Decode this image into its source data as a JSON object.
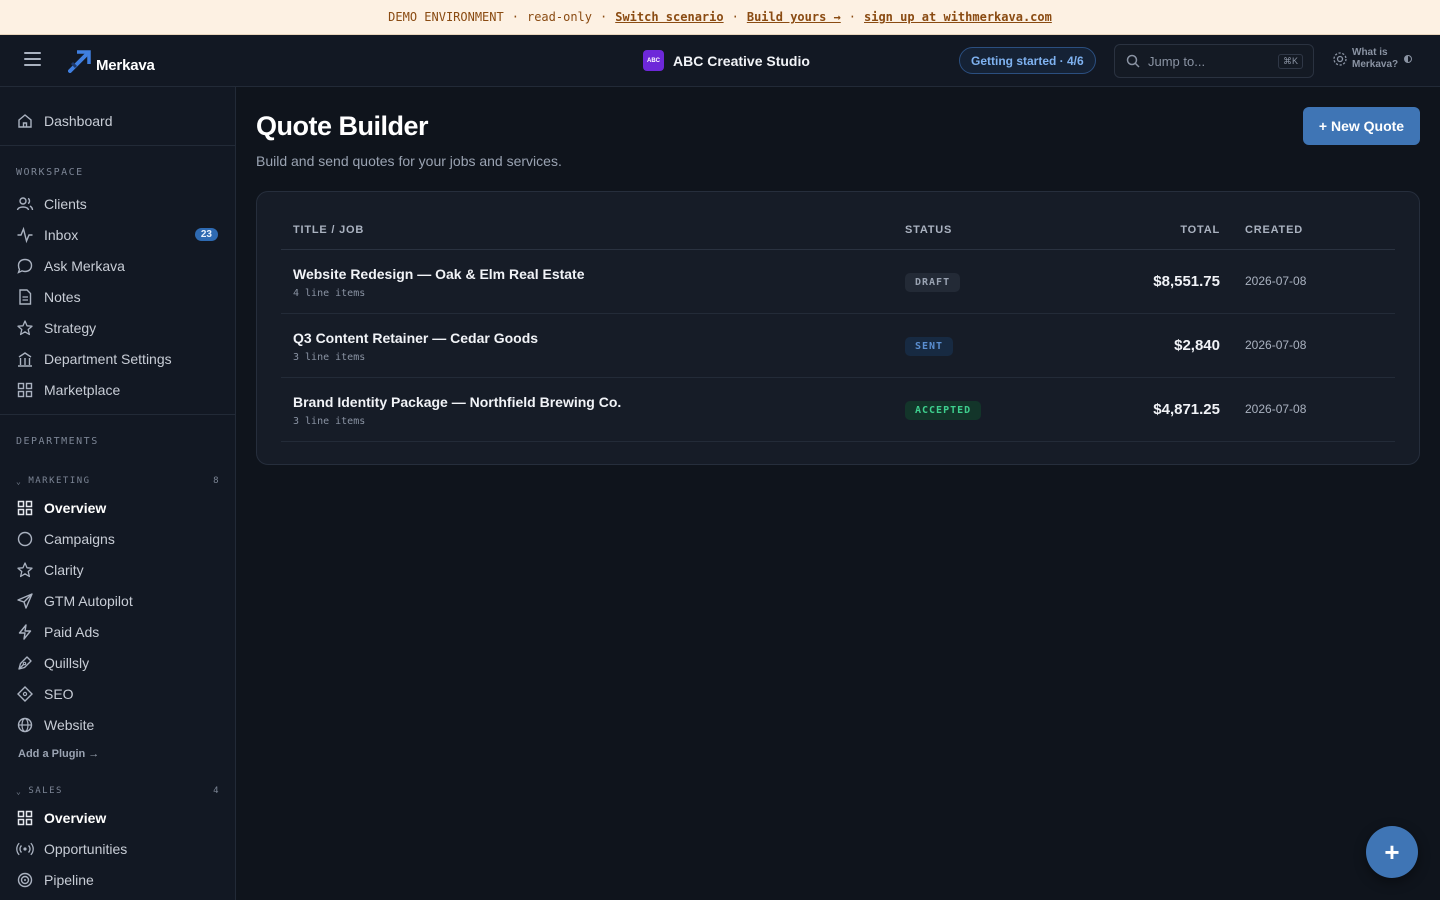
{
  "banner": {
    "env": "DEMO ENVIRONMENT",
    "mode": "read-only",
    "switch_link": "Switch scenario",
    "build_link": "Build yours →",
    "signup_link": "sign up at withmerkava.com",
    "sep": "·"
  },
  "topbar": {
    "brand": "Merkava",
    "org_badge": "ABC",
    "org_name": "ABC Creative Studio",
    "getting_started": "Getting started · 4/6",
    "search_placeholder": "Jump to...",
    "search_shortcut": "⌘K",
    "help": "What is Merkava?"
  },
  "sidebar": {
    "dashboard": "Dashboard",
    "workspace_title": "WORKSPACE",
    "workspace": [
      {
        "label": "Clients",
        "icon": "users-icon"
      },
      {
        "label": "Inbox",
        "icon": "activity-icon",
        "count": "23"
      },
      {
        "label": "Ask Merkava",
        "icon": "chat-icon"
      },
      {
        "label": "Notes",
        "icon": "document-icon"
      },
      {
        "label": "Strategy",
        "icon": "star-icon"
      },
      {
        "label": "Department Settings",
        "icon": "building-icon"
      },
      {
        "label": "Marketplace",
        "icon": "grid-icon"
      }
    ],
    "departments_title": "DEPARTMENTS",
    "marketing": {
      "title": "MARKETING",
      "count": "8",
      "items": [
        {
          "label": "Overview",
          "icon": "grid-icon",
          "active": true
        },
        {
          "label": "Campaigns",
          "icon": "circle-icon"
        },
        {
          "label": "Clarity",
          "icon": "star-icon"
        },
        {
          "label": "GTM Autopilot",
          "icon": "send-icon"
        },
        {
          "label": "Paid Ads",
          "icon": "bolt-icon"
        },
        {
          "label": "Quillsly",
          "icon": "pen-icon"
        },
        {
          "label": "SEO",
          "icon": "diamond-icon"
        },
        {
          "label": "Website",
          "icon": "globe-icon"
        }
      ],
      "add_plugin": "Add a Plugin →"
    },
    "sales": {
      "title": "SALES",
      "count": "4",
      "items": [
        {
          "label": "Overview",
          "icon": "grid-icon",
          "active": true
        },
        {
          "label": "Opportunities",
          "icon": "broadcast-icon"
        },
        {
          "label": "Pipeline",
          "icon": "target-icon"
        }
      ]
    }
  },
  "main": {
    "title": "Quote Builder",
    "subtitle": "Build and send quotes for your jobs and services.",
    "new_quote": "+ New Quote",
    "columns": {
      "title": "TITLE / JOB",
      "status": "STATUS",
      "total": "TOTAL",
      "created": "CREATED"
    },
    "rows": [
      {
        "title": "Website Redesign — Oak & Elm Real Estate",
        "items": "4 line items",
        "status": "DRAFT",
        "total": "$8,551.75",
        "created": "2026-07-08"
      },
      {
        "title": "Q3 Content Retainer — Cedar Goods",
        "items": "3 line items",
        "status": "SENT",
        "total": "$2,840",
        "created": "2026-07-08"
      },
      {
        "title": "Brand Identity Package — Northfield Brewing Co.",
        "items": "3 line items",
        "status": "ACCEPTED",
        "total": "$4,871.25",
        "created": "2026-07-08"
      }
    ]
  },
  "fab": {
    "label": "+"
  },
  "colors": {
    "accent": "#3f75b5",
    "background": "#0f141c",
    "banner_bg": "#fdf1e3",
    "banner_text": "#8a4b12",
    "draft": "#9aa3b2",
    "sent": "#5b8fd1",
    "accepted": "#3ecf8e"
  }
}
